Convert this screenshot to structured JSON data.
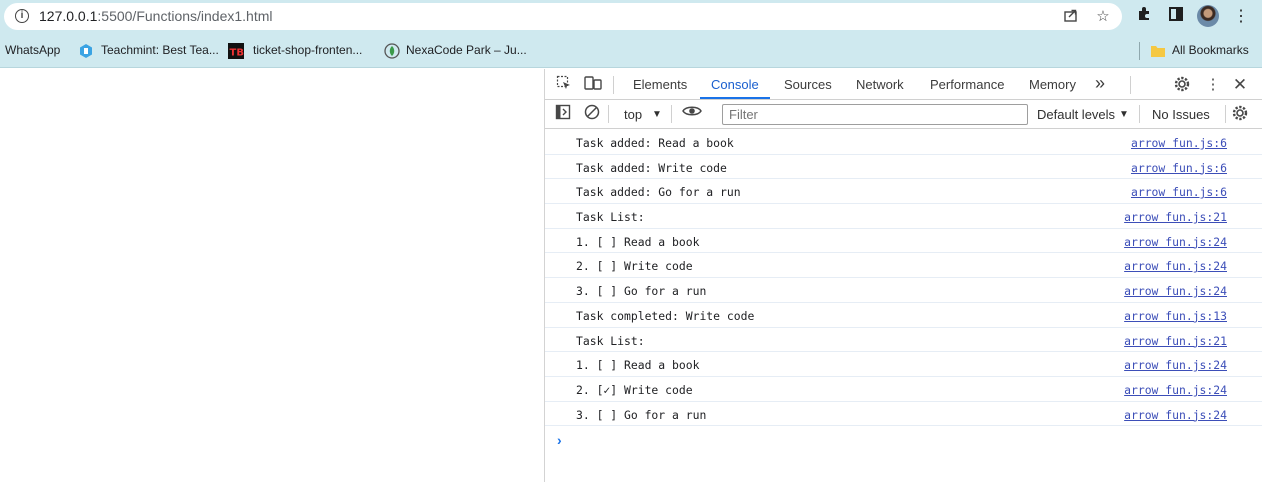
{
  "browser": {
    "url_host": "127.0.0.1",
    "url_path": ":5500/Functions/index1.html",
    "icons": [
      "info-icon",
      "share-icon",
      "star-icon",
      "extensions-icon",
      "sidepanel-icon",
      "avatar",
      "menu-kebab-icon"
    ]
  },
  "bookmarks": {
    "items": [
      {
        "label": "WhatsApp"
      },
      {
        "label": "Teachmint: Best Tea..."
      },
      {
        "label": "ticket-shop-fronten..."
      },
      {
        "label": "NexaCode Park – Ju..."
      }
    ],
    "all_label": "All Bookmarks"
  },
  "devtools": {
    "tabs": [
      {
        "label": "Elements"
      },
      {
        "label": "Console"
      },
      {
        "label": "Sources"
      },
      {
        "label": "Network"
      },
      {
        "label": "Performance"
      },
      {
        "label": "Memory"
      }
    ],
    "more_tabs": "»",
    "active_tab": "Console",
    "toolbar": {
      "context": "top",
      "filter_placeholder": "Filter",
      "levels": "Default levels",
      "issues": "No Issues"
    },
    "console": [
      {
        "message": "Task added: Read a book",
        "source": "arrow fun.js:6"
      },
      {
        "message": "Task added: Write code",
        "source": "arrow fun.js:6"
      },
      {
        "message": "Task added: Go for a run",
        "source": "arrow fun.js:6"
      },
      {
        "message": "Task List:",
        "source": "arrow fun.js:21"
      },
      {
        "message": "1. [ ] Read a book",
        "source": "arrow fun.js:24"
      },
      {
        "message": "2. [ ] Write code",
        "source": "arrow fun.js:24"
      },
      {
        "message": "3. [ ] Go for a run",
        "source": "arrow fun.js:24"
      },
      {
        "message": "Task completed: Write code",
        "source": "arrow fun.js:13"
      },
      {
        "message": "Task List:",
        "source": "arrow fun.js:21"
      },
      {
        "message": "1. [ ] Read a book",
        "source": "arrow fun.js:24"
      },
      {
        "message": "2. [✓] Write code",
        "source": "arrow fun.js:24"
      },
      {
        "message": "3. [ ] Go for a run",
        "source": "arrow fun.js:24"
      }
    ],
    "prompt_symbol": "›"
  }
}
